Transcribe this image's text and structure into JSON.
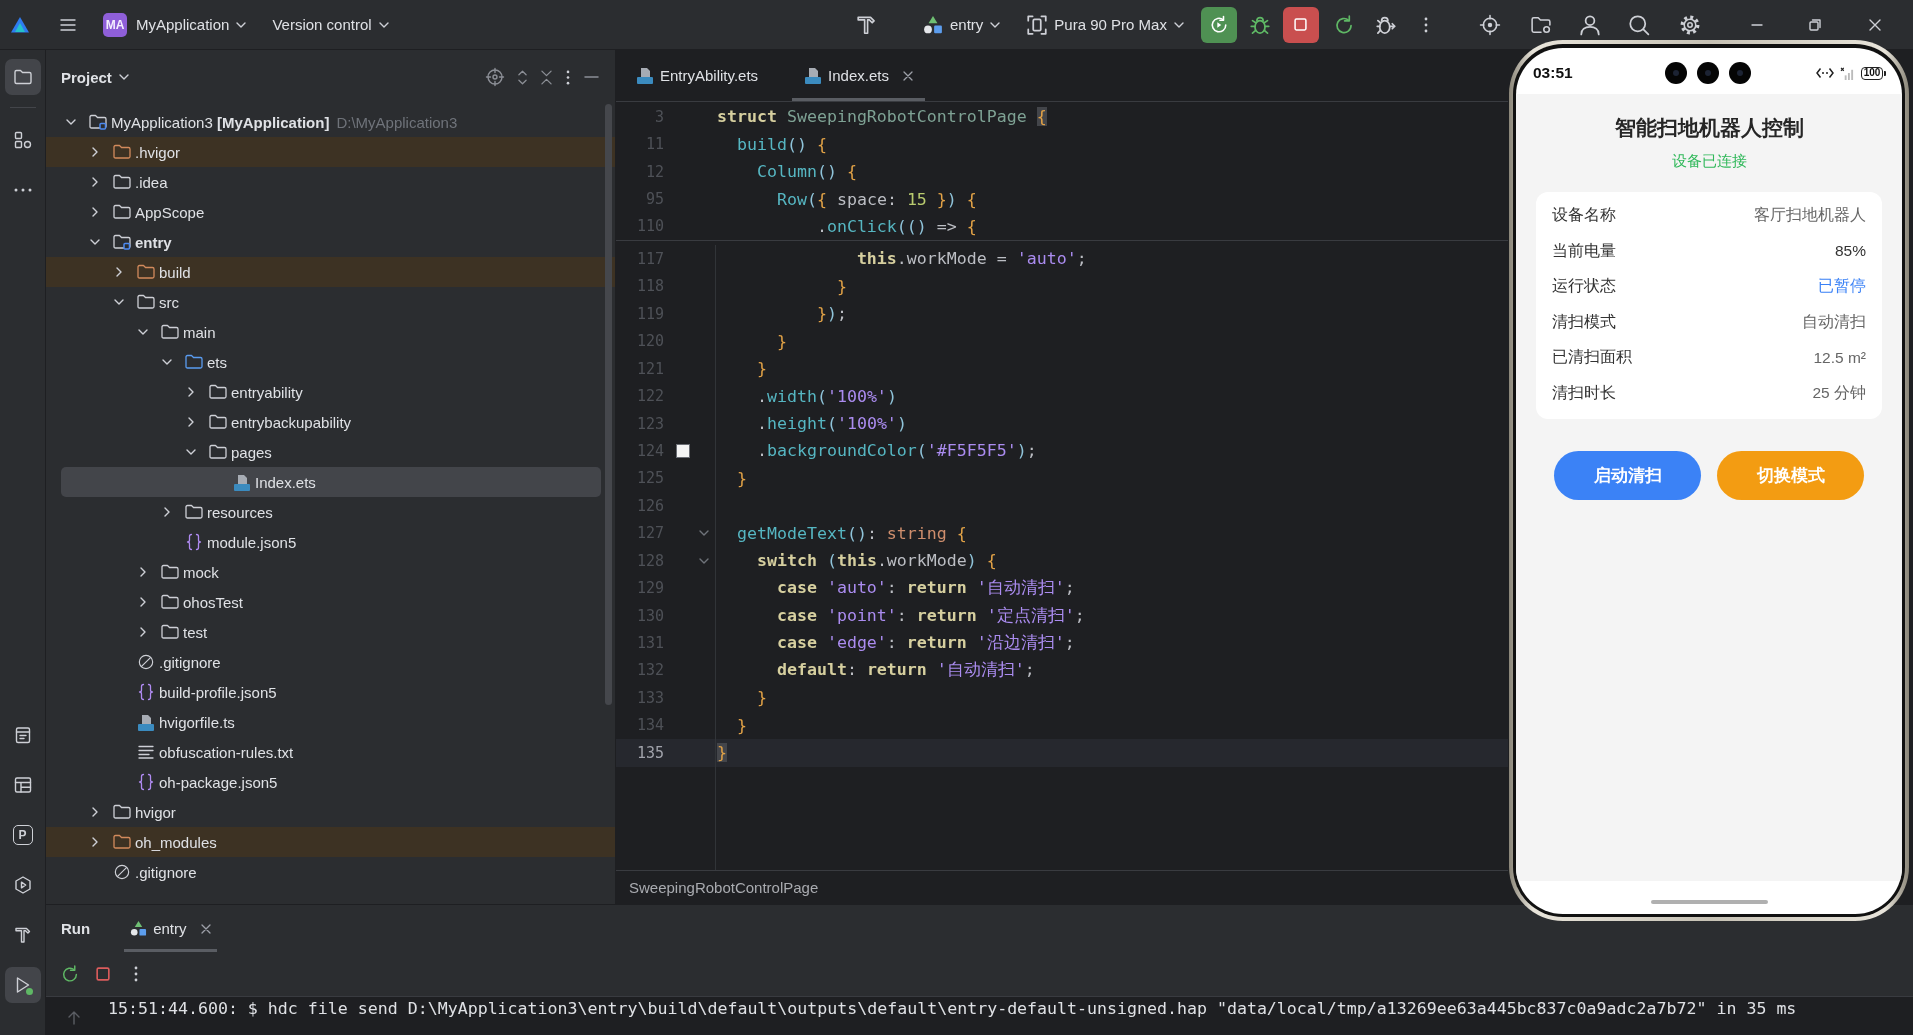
{
  "title_bar": {
    "project_badge": "MA",
    "project_name": "MyApplication",
    "vcs_menu": "Version control",
    "run_config": "entry",
    "device": "Pura 90 Pro Max",
    "app_running": true
  },
  "tool_window_bar": {
    "top": [
      {
        "kind": "project",
        "selected": true
      },
      {
        "kind": "structure",
        "selected": false
      },
      {
        "kind": "more",
        "selected": false
      }
    ],
    "bottom": [
      {
        "kind": "todo",
        "selected": false,
        "running": false
      },
      {
        "kind": "layout",
        "selected": false,
        "running": false
      },
      {
        "kind": "profiler",
        "glyph": "P",
        "selected": false,
        "running": false
      },
      {
        "kind": "services",
        "selected": false,
        "running": false
      },
      {
        "kind": "build",
        "selected": false,
        "running": false
      },
      {
        "kind": "run",
        "selected": true,
        "running": true
      }
    ]
  },
  "project_panel": {
    "title": "Project",
    "tree": [
      {
        "name": "MyApplication3 **[MyApplication]**",
        "path": "D:\\MyApplication3",
        "kind": "project",
        "expanded": true,
        "excluded": false,
        "selected": false,
        "children": [
          {
            "name": ".hvigor",
            "kind": "folder",
            "expanded": false,
            "excluded": true,
            "selected": false
          },
          {
            "name": ".idea",
            "kind": "folder",
            "expanded": false,
            "excluded": false,
            "selected": false
          },
          {
            "name": "AppScope",
            "kind": "folder",
            "expanded": false,
            "excluded": false,
            "selected": false
          },
          {
            "name": "entry",
            "kind": "module",
            "expanded": true,
            "excluded": false,
            "selected": false,
            "children": [
              {
                "name": "build",
                "kind": "folder",
                "expanded": false,
                "excluded": true,
                "selected": false
              },
              {
                "name": "src",
                "kind": "folder",
                "expanded": true,
                "excluded": false,
                "selected": false,
                "children": [
                  {
                    "name": "main",
                    "kind": "folder",
                    "expanded": true,
                    "excluded": false,
                    "selected": false,
                    "children": [
                      {
                        "name": "ets",
                        "kind": "source",
                        "expanded": true,
                        "excluded": false,
                        "selected": false,
                        "children": [
                          {
                            "name": "entryability",
                            "kind": "folder",
                            "expanded": false,
                            "excluded": false,
                            "selected": false
                          },
                          {
                            "name": "entrybackupability",
                            "kind": "folder",
                            "expanded": false,
                            "excluded": false,
                            "selected": false
                          },
                          {
                            "name": "pages",
                            "kind": "folder",
                            "expanded": true,
                            "excluded": false,
                            "selected": false,
                            "children": [
                              {
                                "name": "Index.ets",
                                "kind": "ets",
                                "excluded": false,
                                "selected": true
                              }
                            ]
                          }
                        ]
                      },
                      {
                        "name": "resources",
                        "kind": "folder",
                        "expanded": false,
                        "excluded": false,
                        "selected": false
                      },
                      {
                        "name": "module.json5",
                        "kind": "json",
                        "excluded": false,
                        "selected": false
                      }
                    ]
                  },
                  {
                    "name": "mock",
                    "kind": "folder",
                    "expanded": false,
                    "excluded": false,
                    "selected": false
                  },
                  {
                    "name": "ohosTest",
                    "kind": "folder",
                    "expanded": false,
                    "excluded": false,
                    "selected": false
                  },
                  {
                    "name": "test",
                    "kind": "folder",
                    "expanded": false,
                    "excluded": false,
                    "selected": false
                  }
                ]
              },
              {
                "name": ".gitignore",
                "kind": "ignore",
                "excluded": false,
                "selected": false
              },
              {
                "name": "build-profile.json5",
                "kind": "json",
                "excluded": false,
                "selected": false
              },
              {
                "name": "hvigorfile.ts",
                "kind": "ts",
                "excluded": false,
                "selected": false
              },
              {
                "name": "obfuscation-rules.txt",
                "kind": "text",
                "excluded": false,
                "selected": false
              },
              {
                "name": "oh-package.json5",
                "kind": "json",
                "excluded": false,
                "selected": false
              }
            ]
          },
          {
            "name": "hvigor",
            "kind": "folder",
            "expanded": false,
            "excluded": false,
            "selected": false
          },
          {
            "name": "oh_modules",
            "kind": "folder",
            "expanded": false,
            "excluded": true,
            "selected": false
          },
          {
            "name": ".gitignore",
            "kind": "ignore",
            "excluded": false,
            "selected": false
          }
        ]
      }
    ]
  },
  "editor": {
    "tabs": [
      {
        "name": "EntryAbility.ets",
        "selected": false,
        "closable": false
      },
      {
        "name": "Index.ets",
        "selected": true,
        "closable": true
      }
    ],
    "sticky_lines": [
      {
        "number": "3",
        "tokens": [
          {
            "kind": "keyword",
            "text": "struct"
          },
          {
            "kind": "class",
            "text": " SweepingRobotControlPage "
          },
          {
            "kind": "brace-match",
            "text": "{"
          }
        ]
      },
      {
        "number": "11",
        "tokens": [
          {
            "kind": "call",
            "text": "  build"
          },
          {
            "kind": "paren",
            "text": "()"
          },
          {
            "kind": "brace",
            "text": " {"
          }
        ]
      },
      {
        "number": "12",
        "tokens": [
          {
            "kind": "call",
            "text": "    Column"
          },
          {
            "kind": "paren",
            "text": "()"
          },
          {
            "kind": "brace",
            "text": " {"
          }
        ]
      },
      {
        "number": "95",
        "tokens": [
          {
            "kind": "call",
            "text": "      Row"
          },
          {
            "kind": "paren",
            "text": "("
          },
          {
            "kind": "brace",
            "text": "{"
          },
          {
            "kind": "text",
            "text": " space: "
          },
          {
            "kind": "number",
            "text": "15"
          },
          {
            "kind": "brace",
            "text": " }"
          },
          {
            "kind": "paren",
            "text": ")"
          },
          {
            "kind": "brace",
            "text": " {"
          }
        ]
      },
      {
        "number": "110",
        "tokens": [
          {
            "kind": "text",
            "text": "          ."
          },
          {
            "kind": "call",
            "text": "onClick"
          },
          {
            "kind": "paren",
            "text": "(()"
          },
          {
            "kind": "text",
            "text": " =>"
          },
          {
            "kind": "brace",
            "text": " {"
          }
        ]
      }
    ],
    "lines": [
      {
        "number": "117",
        "current": false,
        "foldable": false,
        "tokens": [
          {
            "kind": "keyword",
            "text": "              this"
          },
          {
            "kind": "text",
            "text": ".workMode = "
          },
          {
            "kind": "string",
            "text": "'auto'"
          },
          {
            "kind": "text",
            "text": ";"
          }
        ]
      },
      {
        "number": "118",
        "current": false,
        "foldable": false,
        "tokens": [
          {
            "kind": "brace",
            "text": "            }"
          }
        ]
      },
      {
        "number": "119",
        "current": false,
        "foldable": false,
        "tokens": [
          {
            "kind": "brace",
            "text": "          }"
          },
          {
            "kind": "paren",
            "text": ")"
          },
          {
            "kind": "text",
            "text": ";"
          }
        ]
      },
      {
        "number": "120",
        "current": false,
        "foldable": false,
        "tokens": [
          {
            "kind": "brace",
            "text": "      }"
          }
        ]
      },
      {
        "number": "121",
        "current": false,
        "foldable": false,
        "tokens": [
          {
            "kind": "brace",
            "text": "    }"
          }
        ]
      },
      {
        "number": "122",
        "current": false,
        "foldable": false,
        "tokens": [
          {
            "kind": "text",
            "text": "    ."
          },
          {
            "kind": "call",
            "text": "width"
          },
          {
            "kind": "paren",
            "text": "("
          },
          {
            "kind": "string",
            "text": "'100%'"
          },
          {
            "kind": "paren",
            "text": ")"
          }
        ]
      },
      {
        "number": "123",
        "current": false,
        "foldable": false,
        "tokens": [
          {
            "kind": "text",
            "text": "    ."
          },
          {
            "kind": "call",
            "text": "height"
          },
          {
            "kind": "paren",
            "text": "("
          },
          {
            "kind": "string",
            "text": "'100%'"
          },
          {
            "kind": "paren",
            "text": ")"
          }
        ]
      },
      {
        "number": "124",
        "current": false,
        "foldable": false,
        "color": "#f5f5f5",
        "tokens": [
          {
            "kind": "text",
            "text": "    ."
          },
          {
            "kind": "call",
            "text": "backgroundColor"
          },
          {
            "kind": "paren",
            "text": "("
          },
          {
            "kind": "string",
            "text": "'#F5F5F5'"
          },
          {
            "kind": "paren",
            "text": ")"
          },
          {
            "kind": "text",
            "text": ";"
          }
        ]
      },
      {
        "number": "125",
        "current": false,
        "foldable": false,
        "tokens": [
          {
            "kind": "brace",
            "text": "  }"
          }
        ]
      },
      {
        "number": "126",
        "current": false,
        "foldable": false
      },
      {
        "number": "127",
        "current": false,
        "foldable": true,
        "tokens": [
          {
            "kind": "call",
            "text": "  getModeText"
          },
          {
            "kind": "paren",
            "text": "()"
          },
          {
            "kind": "text",
            "text": ": "
          },
          {
            "kind": "type",
            "text": "string"
          },
          {
            "kind": "brace",
            "text": " {"
          }
        ]
      },
      {
        "number": "128",
        "current": false,
        "foldable": true,
        "tokens": [
          {
            "kind": "keyword",
            "text": "    switch"
          },
          {
            "kind": "paren",
            "text": " ("
          },
          {
            "kind": "keyword",
            "text": "this"
          },
          {
            "kind": "text",
            "text": ".workMode"
          },
          {
            "kind": "paren",
            "text": ")"
          },
          {
            "kind": "brace",
            "text": " {"
          }
        ]
      },
      {
        "number": "129",
        "current": false,
        "foldable": false,
        "tokens": [
          {
            "kind": "keyword",
            "text": "      case"
          },
          {
            "kind": "string",
            "text": " 'auto'"
          },
          {
            "kind": "text",
            "text": ":"
          },
          {
            "kind": "keyword",
            "text": " return"
          },
          {
            "kind": "string",
            "text": " '自动清扫'"
          },
          {
            "kind": "text",
            "text": ";"
          }
        ]
      },
      {
        "number": "130",
        "current": false,
        "foldable": false,
        "tokens": [
          {
            "kind": "keyword",
            "text": "      case"
          },
          {
            "kind": "string",
            "text": " 'point'"
          },
          {
            "kind": "text",
            "text": ":"
          },
          {
            "kind": "keyword",
            "text": " return"
          },
          {
            "kind": "string",
            "text": " '定点清扫'"
          },
          {
            "kind": "text",
            "text": ";"
          }
        ]
      },
      {
        "number": "131",
        "current": false,
        "foldable": false,
        "tokens": [
          {
            "kind": "keyword",
            "text": "      case"
          },
          {
            "kind": "string",
            "text": " 'edge'"
          },
          {
            "kind": "text",
            "text": ":"
          },
          {
            "kind": "keyword",
            "text": " return"
          },
          {
            "kind": "string",
            "text": " '沿边清扫'"
          },
          {
            "kind": "text",
            "text": ";"
          }
        ]
      },
      {
        "number": "132",
        "current": false,
        "foldable": false,
        "tokens": [
          {
            "kind": "keyword",
            "text": "      default"
          },
          {
            "kind": "text",
            "text": ":"
          },
          {
            "kind": "keyword",
            "text": " return"
          },
          {
            "kind": "string",
            "text": " '自动清扫'"
          },
          {
            "kind": "text",
            "text": ";"
          }
        ]
      },
      {
        "number": "133",
        "current": false,
        "foldable": false,
        "tokens": [
          {
            "kind": "brace",
            "text": "    }"
          }
        ]
      },
      {
        "number": "134",
        "current": false,
        "foldable": false,
        "tokens": [
          {
            "kind": "brace",
            "text": "  }"
          }
        ]
      },
      {
        "number": "135",
        "current": true,
        "foldable": false,
        "tokens": [
          {
            "kind": "brace-match",
            "text": "}"
          }
        ]
      }
    ],
    "breadcrumb": "SweepingRobotControlPage"
  },
  "emulator": {
    "status_bar": {
      "time": "03:51",
      "battery": "100"
    },
    "title": "智能扫地机器人控制",
    "connection": "设备已连接",
    "connected": true,
    "info_rows": [
      {
        "label": "设备名称",
        "value": "客厅扫地机器人",
        "color": "#666666"
      },
      {
        "label": "当前电量",
        "value": "85%",
        "color": "#333333"
      },
      {
        "label": "运行状态",
        "value": "已暂停",
        "color": "#3b82f6"
      },
      {
        "label": "清扫模式",
        "value": "自动清扫",
        "color": "#666666"
      },
      {
        "label": "已清扫面积",
        "value": "12.5 m²",
        "color": "#666666"
      },
      {
        "label": "清扫时长",
        "value": "25 分钟",
        "color": "#666666"
      }
    ],
    "buttons": [
      {
        "label": "启动清扫",
        "color": "#3b82f6"
      },
      {
        "label": "切换模式",
        "color": "#f39c12"
      }
    ]
  },
  "run_panel": {
    "title": "Run",
    "tabs": [
      {
        "label": "entry",
        "selected": true,
        "closable": true
      }
    ],
    "stop_enabled": true,
    "log": [
      "15:51:44.600: $ hdc file send D:\\MyApplication3\\entry\\build\\default\\outputs\\default\\entry-default-unsigned.hap \"data/local/tmp/a13269ee63a445bc837c0a9adc2a7b72\" in 35 ms"
    ]
  }
}
